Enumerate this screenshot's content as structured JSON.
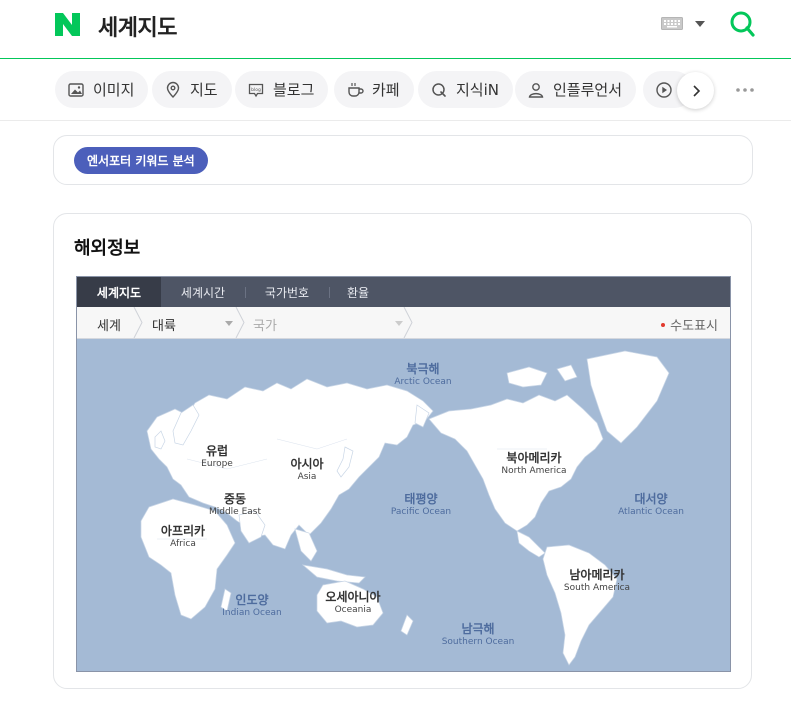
{
  "header": {
    "title": "세계지도"
  },
  "tabs": [
    {
      "label": "이미지",
      "icon": "image-icon"
    },
    {
      "label": "지도",
      "icon": "map-pin-icon"
    },
    {
      "label": "블로그",
      "icon": "blog-icon"
    },
    {
      "label": "카페",
      "icon": "cafe-cup-icon"
    },
    {
      "label": "지식iN",
      "icon": "knowledge-q-icon"
    },
    {
      "label": "인플루언서",
      "icon": "person-icon"
    },
    {
      "label": "",
      "icon": "play-icon"
    }
  ],
  "keyword_card": {
    "chip_label": "엔서포터 키워드 분석"
  },
  "info_card": {
    "title": "해외정보",
    "map_tabs": [
      "세계지도",
      "세계시간",
      "국가번호",
      "환율"
    ],
    "breadcrumb": {
      "world": "세계",
      "continent": "대륙",
      "country": "국가"
    },
    "capital_label": "수도표시",
    "continents": [
      {
        "ko": "유럽",
        "en": "Europe"
      },
      {
        "ko": "아시아",
        "en": "Asia"
      },
      {
        "ko": "중동",
        "en": "Middle East"
      },
      {
        "ko": "아프리카",
        "en": "Africa"
      },
      {
        "ko": "북아메리카",
        "en": "North America"
      },
      {
        "ko": "남아메리카",
        "en": "South America"
      },
      {
        "ko": "오세아니아",
        "en": "Oceania"
      }
    ],
    "oceans": [
      {
        "ko": "북극해",
        "en": "Arctic Ocean"
      },
      {
        "ko": "태평양",
        "en": "Pacific Ocean"
      },
      {
        "ko": "대서양",
        "en": "Atlantic Ocean"
      },
      {
        "ko": "인도양",
        "en": "Indian Ocean"
      },
      {
        "ko": "남극해",
        "en": "Southern Ocean"
      }
    ]
  },
  "colors": {
    "brand_green": "#03c75a",
    "chip_blue": "#4c5fbb",
    "map_ocean": "#a4bad5",
    "map_tab_bg": "#4e5565",
    "capital_dot": "#e23a2e"
  }
}
